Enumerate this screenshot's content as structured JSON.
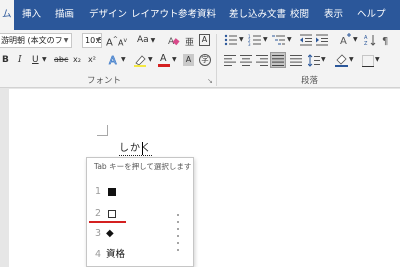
{
  "ribbon_tabs": [
    "ム",
    "挿入",
    "描画",
    "デザイン",
    "レイアウト",
    "参考資料",
    "差し込み文書",
    "校閲",
    "表示",
    "ヘルプ"
  ],
  "font": {
    "name": "游明朝 (本文のフ",
    "size": "10.5",
    "grow_label": "A",
    "shrink_label": "A",
    "case_label": "Aa",
    "bold": "B",
    "italic": "I",
    "underline": "U",
    "strikethrough": "abc",
    "subscript": "x₂",
    "superscript": "x²",
    "font_color": "A",
    "group_label": "フォント"
  },
  "paragraph": {
    "group_label": "段落"
  },
  "document": {
    "ime_text": "しかく"
  },
  "ime_popup": {
    "hint": "Tab キーを押して選択します",
    "candidates": [
      {
        "number": "1",
        "symbol": "■"
      },
      {
        "number": "2",
        "symbol": "□"
      },
      {
        "number": "3",
        "symbol": "◆"
      },
      {
        "number": "4",
        "symbol": "資格"
      }
    ]
  },
  "colors": {
    "tab_bar": "#2b579a",
    "ribbon": "#f3f3f3",
    "highlight_underline": "#d42020",
    "font_color_red": "#d42020"
  }
}
